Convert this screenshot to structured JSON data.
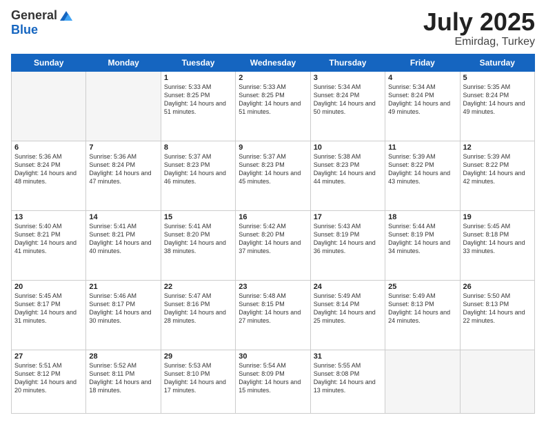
{
  "header": {
    "logo_general": "General",
    "logo_blue": "Blue",
    "month": "July 2025",
    "location": "Emirdag, Turkey"
  },
  "weekdays": [
    "Sunday",
    "Monday",
    "Tuesday",
    "Wednesday",
    "Thursday",
    "Friday",
    "Saturday"
  ],
  "weeks": [
    [
      {
        "day": "",
        "empty": true
      },
      {
        "day": "",
        "empty": true
      },
      {
        "day": "1",
        "sunrise": "5:33 AM",
        "sunset": "8:25 PM",
        "daylight": "14 hours and 51 minutes."
      },
      {
        "day": "2",
        "sunrise": "5:33 AM",
        "sunset": "8:25 PM",
        "daylight": "14 hours and 51 minutes."
      },
      {
        "day": "3",
        "sunrise": "5:34 AM",
        "sunset": "8:24 PM",
        "daylight": "14 hours and 50 minutes."
      },
      {
        "day": "4",
        "sunrise": "5:34 AM",
        "sunset": "8:24 PM",
        "daylight": "14 hours and 49 minutes."
      },
      {
        "day": "5",
        "sunrise": "5:35 AM",
        "sunset": "8:24 PM",
        "daylight": "14 hours and 49 minutes."
      }
    ],
    [
      {
        "day": "6",
        "sunrise": "5:36 AM",
        "sunset": "8:24 PM",
        "daylight": "14 hours and 48 minutes."
      },
      {
        "day": "7",
        "sunrise": "5:36 AM",
        "sunset": "8:24 PM",
        "daylight": "14 hours and 47 minutes."
      },
      {
        "day": "8",
        "sunrise": "5:37 AM",
        "sunset": "8:23 PM",
        "daylight": "14 hours and 46 minutes."
      },
      {
        "day": "9",
        "sunrise": "5:37 AM",
        "sunset": "8:23 PM",
        "daylight": "14 hours and 45 minutes."
      },
      {
        "day": "10",
        "sunrise": "5:38 AM",
        "sunset": "8:23 PM",
        "daylight": "14 hours and 44 minutes."
      },
      {
        "day": "11",
        "sunrise": "5:39 AM",
        "sunset": "8:22 PM",
        "daylight": "14 hours and 43 minutes."
      },
      {
        "day": "12",
        "sunrise": "5:39 AM",
        "sunset": "8:22 PM",
        "daylight": "14 hours and 42 minutes."
      }
    ],
    [
      {
        "day": "13",
        "sunrise": "5:40 AM",
        "sunset": "8:21 PM",
        "daylight": "14 hours and 41 minutes."
      },
      {
        "day": "14",
        "sunrise": "5:41 AM",
        "sunset": "8:21 PM",
        "daylight": "14 hours and 40 minutes."
      },
      {
        "day": "15",
        "sunrise": "5:41 AM",
        "sunset": "8:20 PM",
        "daylight": "14 hours and 38 minutes."
      },
      {
        "day": "16",
        "sunrise": "5:42 AM",
        "sunset": "8:20 PM",
        "daylight": "14 hours and 37 minutes."
      },
      {
        "day": "17",
        "sunrise": "5:43 AM",
        "sunset": "8:19 PM",
        "daylight": "14 hours and 36 minutes."
      },
      {
        "day": "18",
        "sunrise": "5:44 AM",
        "sunset": "8:19 PM",
        "daylight": "14 hours and 34 minutes."
      },
      {
        "day": "19",
        "sunrise": "5:45 AM",
        "sunset": "8:18 PM",
        "daylight": "14 hours and 33 minutes."
      }
    ],
    [
      {
        "day": "20",
        "sunrise": "5:45 AM",
        "sunset": "8:17 PM",
        "daylight": "14 hours and 31 minutes."
      },
      {
        "day": "21",
        "sunrise": "5:46 AM",
        "sunset": "8:17 PM",
        "daylight": "14 hours and 30 minutes."
      },
      {
        "day": "22",
        "sunrise": "5:47 AM",
        "sunset": "8:16 PM",
        "daylight": "14 hours and 28 minutes."
      },
      {
        "day": "23",
        "sunrise": "5:48 AM",
        "sunset": "8:15 PM",
        "daylight": "14 hours and 27 minutes."
      },
      {
        "day": "24",
        "sunrise": "5:49 AM",
        "sunset": "8:14 PM",
        "daylight": "14 hours and 25 minutes."
      },
      {
        "day": "25",
        "sunrise": "5:49 AM",
        "sunset": "8:13 PM",
        "daylight": "14 hours and 24 minutes."
      },
      {
        "day": "26",
        "sunrise": "5:50 AM",
        "sunset": "8:13 PM",
        "daylight": "14 hours and 22 minutes."
      }
    ],
    [
      {
        "day": "27",
        "sunrise": "5:51 AM",
        "sunset": "8:12 PM",
        "daylight": "14 hours and 20 minutes."
      },
      {
        "day": "28",
        "sunrise": "5:52 AM",
        "sunset": "8:11 PM",
        "daylight": "14 hours and 18 minutes."
      },
      {
        "day": "29",
        "sunrise": "5:53 AM",
        "sunset": "8:10 PM",
        "daylight": "14 hours and 17 minutes."
      },
      {
        "day": "30",
        "sunrise": "5:54 AM",
        "sunset": "8:09 PM",
        "daylight": "14 hours and 15 minutes."
      },
      {
        "day": "31",
        "sunrise": "5:55 AM",
        "sunset": "8:08 PM",
        "daylight": "14 hours and 13 minutes."
      },
      {
        "day": "",
        "empty": true
      },
      {
        "day": "",
        "empty": true
      }
    ]
  ]
}
